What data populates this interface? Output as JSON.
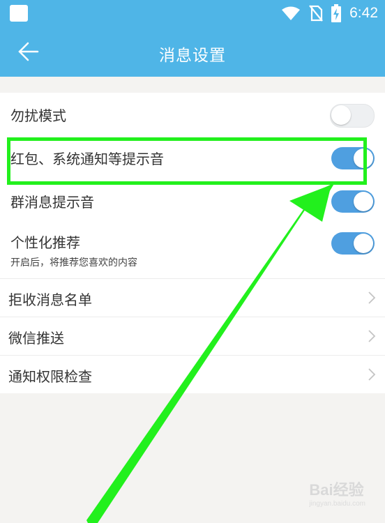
{
  "status_bar": {
    "time": "6:42",
    "icons": [
      "wifi-icon",
      "no-sim-icon",
      "battery-charging-icon"
    ]
  },
  "header": {
    "title": "消息设置",
    "back_icon": "back-arrow-icon"
  },
  "settings": {
    "dnd": {
      "label": "勿扰模式",
      "enabled": false
    },
    "red_packet_sound": {
      "label": "红包、系统通知等提示音",
      "enabled": true
    },
    "group_sound": {
      "label": "群消息提示音",
      "enabled": true
    },
    "personalized": {
      "label": "个性化推荐",
      "sublabel": "开启后，将推荐您喜欢的内容",
      "enabled": true
    },
    "reject_list": {
      "label": "拒收消息名单"
    },
    "wechat_push": {
      "label": "微信推送"
    },
    "permission_check": {
      "label": "通知权限检查"
    }
  },
  "watermark": {
    "text": "Bai经验",
    "sub": "jingyan.baidu.com"
  },
  "colors": {
    "header_bg": "#4fb5e7",
    "toggle_on": "#4f9fe0",
    "annotation_green": "#22f01d"
  }
}
